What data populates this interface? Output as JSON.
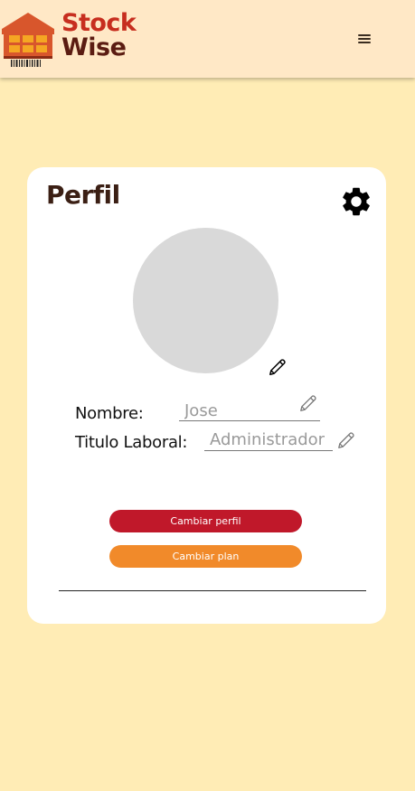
{
  "header": {
    "brand_line1": "Stock",
    "brand_line2": "Wise",
    "menu_icon": "hamburger-menu-icon"
  },
  "profile": {
    "title": "Perfil",
    "settings_icon": "gear-icon",
    "name_label": "Nombre:",
    "name_value": "Jose",
    "job_label": "Titulo Laboral:",
    "job_value": "Administrador",
    "change_profile_label": "Cambiar perfil",
    "change_plan_label": "Cambiar plan"
  },
  "colors": {
    "page_bg": "#ffecb5",
    "header_bg": "#ffe8c6",
    "brand_red": "#c72e1f",
    "brand_brown": "#5b1c12",
    "button_red": "#c0182a",
    "button_orange": "#f18a2a",
    "avatar_gray": "#d9d9d9"
  }
}
